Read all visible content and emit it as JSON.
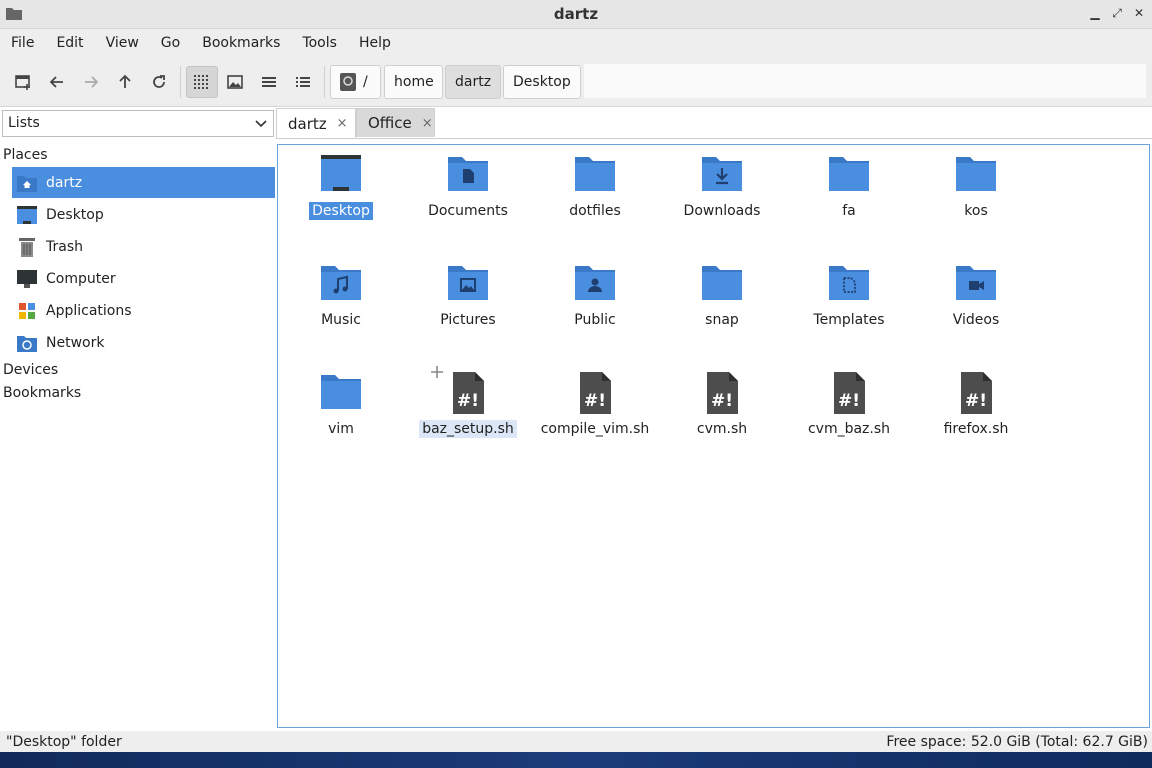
{
  "window": {
    "title": "dartz"
  },
  "menu": [
    "File",
    "Edit",
    "View",
    "Go",
    "Bookmarks",
    "Tools",
    "Help"
  ],
  "path": {
    "root": "/",
    "segments": [
      "home",
      "dartz",
      "Desktop"
    ]
  },
  "side_pane": {
    "mode": "Lists"
  },
  "tabs": [
    {
      "label": "dartz",
      "close": "×"
    },
    {
      "label": "Office",
      "close": "×"
    }
  ],
  "sidebar": {
    "places_label": "Places",
    "places": [
      {
        "label": "dartz",
        "icon": "home-folder-icon"
      },
      {
        "label": "Desktop",
        "icon": "desktop-icon"
      },
      {
        "label": "Trash",
        "icon": "trash-icon"
      },
      {
        "label": "Computer",
        "icon": "computer-icon"
      },
      {
        "label": "Applications",
        "icon": "applications-icon"
      },
      {
        "label": "Network",
        "icon": "network-icon"
      }
    ],
    "devices_label": "Devices",
    "bookmarks_label": "Bookmarks"
  },
  "files": [
    {
      "name": "Desktop",
      "type": "desktop-folder"
    },
    {
      "name": "Documents",
      "type": "documents-folder"
    },
    {
      "name": "dotfiles",
      "type": "folder"
    },
    {
      "name": "Downloads",
      "type": "downloads-folder"
    },
    {
      "name": "fa",
      "type": "folder"
    },
    {
      "name": "kos",
      "type": "folder"
    },
    {
      "name": "Music",
      "type": "music-folder"
    },
    {
      "name": "Pictures",
      "type": "pictures-folder"
    },
    {
      "name": "Public",
      "type": "public-folder"
    },
    {
      "name": "snap",
      "type": "folder"
    },
    {
      "name": "Templates",
      "type": "templates-folder"
    },
    {
      "name": "Videos",
      "type": "videos-folder"
    },
    {
      "name": "vim",
      "type": "folder"
    },
    {
      "name": "baz_setup.sh",
      "type": "script"
    },
    {
      "name": "compile_vim.sh",
      "type": "script"
    },
    {
      "name": "cvm.sh",
      "type": "script"
    },
    {
      "name": "cvm_baz.sh",
      "type": "script"
    },
    {
      "name": "firefox.sh",
      "type": "script"
    }
  ],
  "status": {
    "selection": "\"Desktop\" folder",
    "free_space": "Free space: 52.0 GiB (Total: 62.7 GiB)"
  },
  "colors": {
    "accent": "#4a8ee0",
    "folder": "#4a8ee0",
    "script": "#4d4d4d"
  }
}
